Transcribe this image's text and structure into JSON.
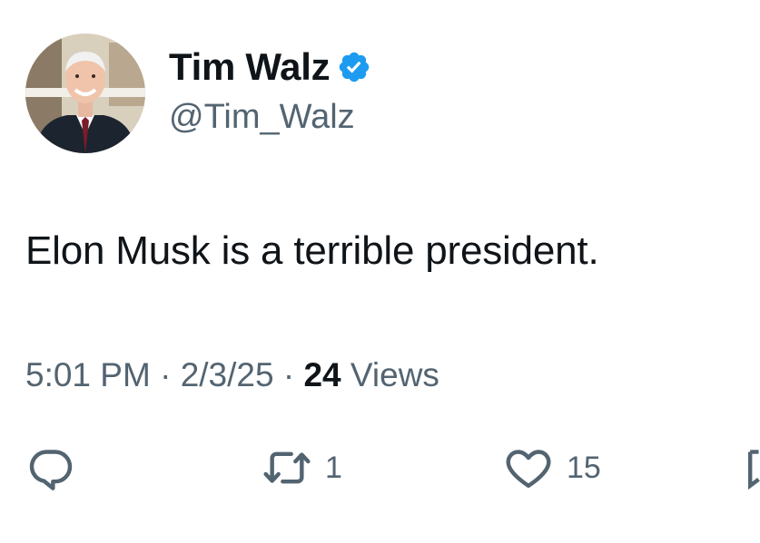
{
  "author": {
    "display_name": "Tim Walz",
    "handle": "@Tim_Walz",
    "verified_icon": "verified-badge-icon",
    "verified_color": "#1d9bf0"
  },
  "tweet": {
    "text": "Elon Musk is a terrible president."
  },
  "meta": {
    "time": "5:01 PM",
    "separator": "·",
    "date": "2/3/25",
    "views_count": "24",
    "views_label": "Views"
  },
  "actions": {
    "reply_icon": "reply-icon",
    "retweet_icon": "retweet-icon",
    "retweet_count": "1",
    "like_icon": "heart-icon",
    "like_count": "15",
    "bookmark_icon": "bookmark-icon"
  },
  "colors": {
    "text_primary": "#0f1419",
    "text_secondary": "#536471",
    "accent": "#1d9bf0"
  }
}
